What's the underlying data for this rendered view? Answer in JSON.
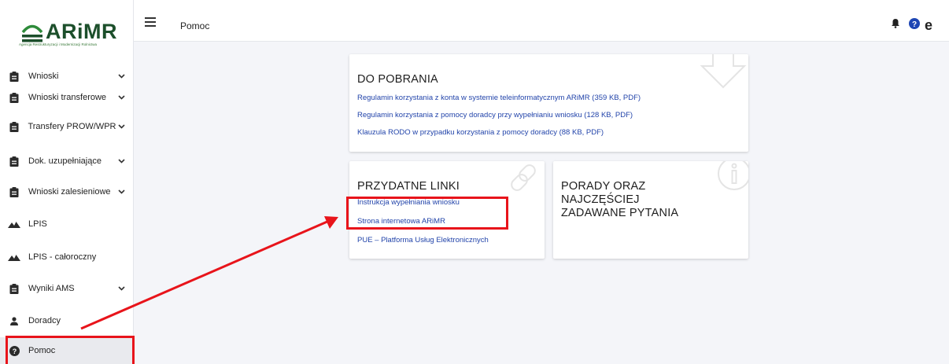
{
  "logo": {
    "wordmark": "ARiMR",
    "subtitle": "Agencja Restrukturyzacji i Modernizacji Rolnictwa"
  },
  "topbar": {
    "title": "Pomoc",
    "user_initial": "e"
  },
  "sidebar": {
    "items": [
      {
        "label": "Wnioski",
        "icon": "clipboard-icon",
        "has_chevron": true
      },
      {
        "label": "Wnioski transferowe",
        "icon": "clipboard-icon",
        "has_chevron": true
      },
      {
        "label": "Transfery PROW/WPR",
        "icon": "clipboard-icon",
        "has_chevron": true
      },
      {
        "label": "Dok. uzupełniające",
        "icon": "clipboard-icon",
        "has_chevron": true
      },
      {
        "label": "Wnioski zalesieniowe",
        "icon": "clipboard-icon",
        "has_chevron": true
      },
      {
        "label": "LPIS",
        "icon": "mountain-icon",
        "has_chevron": false
      },
      {
        "label": "LPIS - całoroczny",
        "icon": "mountain-icon",
        "has_chevron": false
      },
      {
        "label": "Wyniki AMS",
        "icon": "clipboard-icon",
        "has_chevron": true
      },
      {
        "label": "Doradcy",
        "icon": "person-icon",
        "has_chevron": false
      },
      {
        "label": "Pomoc",
        "icon": "help-circle-icon",
        "has_chevron": false,
        "active": true
      }
    ]
  },
  "downloads": {
    "title": "DO POBRANIA",
    "links": [
      "Regulamin korzystania z konta w systemie teleinformatycznym ARiMR (359 KB, PDF)",
      "Regulamin korzystania z pomocy doradcy przy wypełnianiu wniosku (128 KB, PDF)",
      "Klauzula RODO w przypadku korzystania z pomocy doradcy (88 KB, PDF)"
    ]
  },
  "useful_links": {
    "title": "PRZYDATNE LINKI",
    "links": [
      "Instrukcja wypełniania wniosku",
      "Strona internetowa ARiMR",
      "PUE – Platforma Usług Elektronicznych"
    ]
  },
  "faq": {
    "title_lines": [
      "PORADY ORAZ",
      "NAJCZĘŚCIEJ",
      "ZADAWANE PYTANIA"
    ]
  },
  "colors": {
    "link": "#2244aa",
    "highlight": "#e8141b",
    "logo_green": "#1c4f2b",
    "background": "#f4f5f9"
  }
}
